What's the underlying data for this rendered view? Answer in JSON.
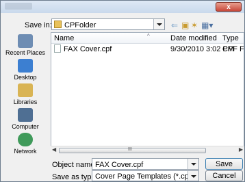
{
  "titlebar": {
    "close_label": "x"
  },
  "savein": {
    "label": "Save in:",
    "folder": "CPFolder"
  },
  "places": [
    {
      "label": "Recent Places",
      "icon": "recent-places-icon"
    },
    {
      "label": "Desktop",
      "icon": "desktop-icon"
    },
    {
      "label": "Libraries",
      "icon": "libraries-icon"
    },
    {
      "label": "Computer",
      "icon": "computer-icon"
    },
    {
      "label": "Network",
      "icon": "network-icon"
    }
  ],
  "columns": {
    "name": "Name",
    "date": "Date modified",
    "type": "Type"
  },
  "files": [
    {
      "name": "FAX Cover.cpf",
      "date": "9/30/2010 3:02 PM",
      "type": "CPF File"
    }
  ],
  "scroll_grip": "III",
  "object_name": {
    "label": "Object name:",
    "value": "FAX Cover.cpf"
  },
  "save_as_type": {
    "label": "Save as type:",
    "value": "Cover Page Templates (*.cpf)"
  },
  "buttons": {
    "save": "Save",
    "cancel": "Cancel"
  }
}
